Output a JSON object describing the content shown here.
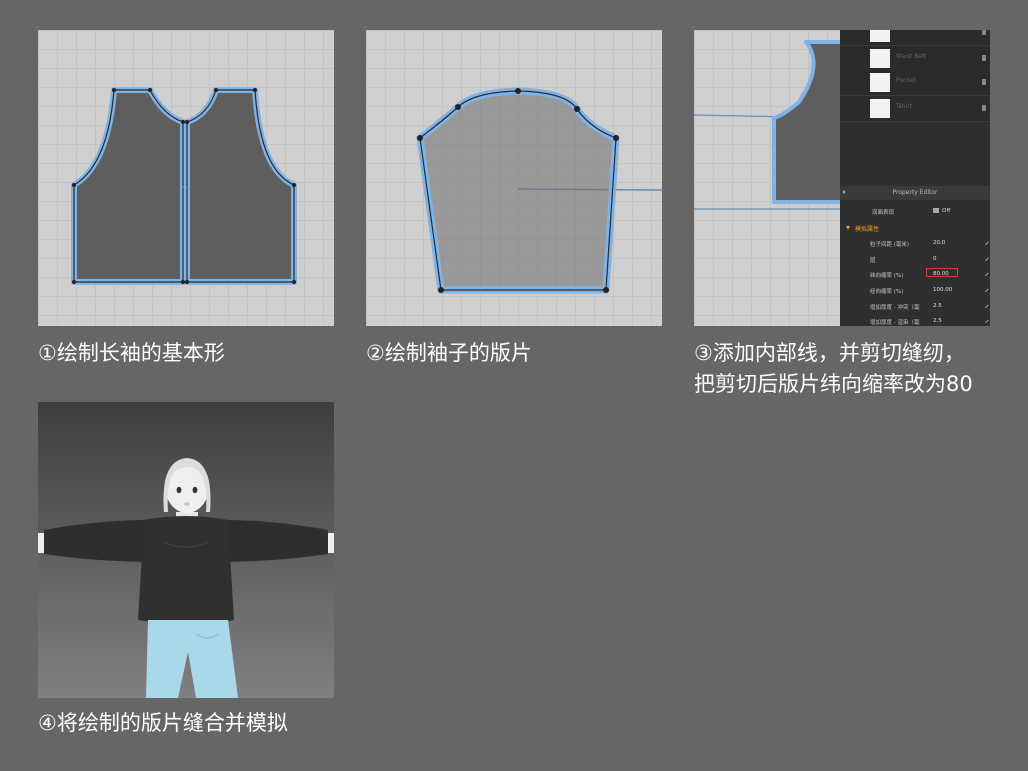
{
  "captions": {
    "step1": "①绘制长袖的基本形",
    "step2": "②绘制袖子的版片",
    "step3_line1": "③添加内部线，并剪切缝纫，",
    "step3_line2": "把剪切后版片纬向缩率改为80",
    "step4": "④将绘制的版片缝合并模拟"
  },
  "property_editor": {
    "list_items": [
      "",
      "Waist Belt",
      "Pocket",
      "Tshirt"
    ],
    "header": "Property Editor",
    "display_label": "双面表现",
    "display_value": "Off",
    "section": "模拟属性",
    "rows": [
      {
        "label": "粒子间距 (毫米)",
        "value": "20.0"
      },
      {
        "label": "层",
        "value": "0"
      },
      {
        "label": "纬向缩率 (%)",
        "value": "80.00"
      },
      {
        "label": "经向缩率 (%)",
        "value": "100.00"
      },
      {
        "label": "增加厚度 - 冲突（毫",
        "value": "2.5"
      },
      {
        "label": "增加厚度 - 渲染（毫",
        "value": "2.5"
      }
    ]
  },
  "colors": {
    "background": "#666666",
    "canvas": "#cfcfcf",
    "pattern_fill": "#5e5e5e",
    "pattern_outline": "#7fb2e5",
    "highlight": "#e23a2a",
    "section_text": "#f0a020"
  },
  "icons": [
    "pattern-point-icon",
    "lock-icon",
    "edit-pencil-icon",
    "collapse-arrow-icon"
  ]
}
